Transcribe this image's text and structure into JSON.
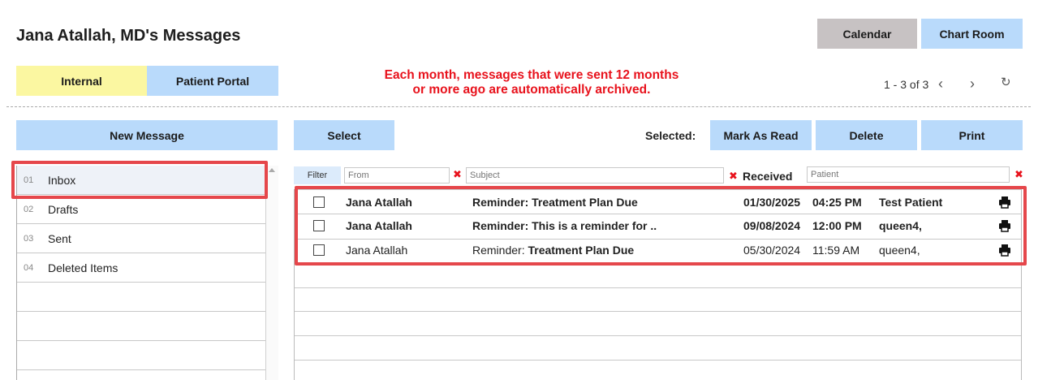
{
  "header": {
    "title": "Jana Atallah, MD's Messages",
    "calendar_label": "Calendar",
    "chart_room_label": "Chart Room"
  },
  "tabs": [
    {
      "label": "Internal",
      "color": "#fbf7a1"
    },
    {
      "label": "Patient Portal",
      "color": "#b9dafb"
    }
  ],
  "notice": {
    "line1": "Each month, messages that were sent 12 months",
    "line2": "or more ago are automatically archived.",
    "color": "#e8121c"
  },
  "pager": {
    "range": "1 - 3 of 3",
    "prev_icon": "chevron-left-icon",
    "next_icon": "chevron-right-icon",
    "refresh_icon": "refresh-icon"
  },
  "toolbar": {
    "new_message": "New Message",
    "select": "Select",
    "selected_label": "Selected:",
    "mark_as_read": "Mark As Read",
    "delete": "Delete",
    "print": "Print"
  },
  "folders": [
    {
      "num": "01",
      "label": "Inbox",
      "active": true
    },
    {
      "num": "02",
      "label": "Drafts"
    },
    {
      "num": "03",
      "label": "Sent"
    },
    {
      "num": "04",
      "label": "Deleted Items"
    }
  ],
  "filter": {
    "label": "Filter",
    "from_placeholder": "From",
    "subject_placeholder": "Subject",
    "received_label": "Received",
    "patient_placeholder": "Patient"
  },
  "messages": [
    {
      "from": "Jana Atallah",
      "subject": "Reminder: Treatment Plan Due",
      "subject_prefix": "",
      "date": "01/30/2025",
      "time": "04:25 PM",
      "patient": "Test Patient",
      "unread": true
    },
    {
      "from": "Jana Atallah",
      "subject": "Reminder: This is a reminder for ..",
      "subject_prefix": "",
      "date": "09/08/2024",
      "time": "12:00 PM",
      "patient": "queen4,",
      "unread": true
    },
    {
      "from": "Jana Atallah",
      "subject": "Treatment Plan Due",
      "subject_prefix": "Reminder: ",
      "date": "05/30/2024",
      "time": "11:59 AM",
      "patient": "queen4,",
      "unread": false
    }
  ],
  "highlight_color": "#e5474b"
}
